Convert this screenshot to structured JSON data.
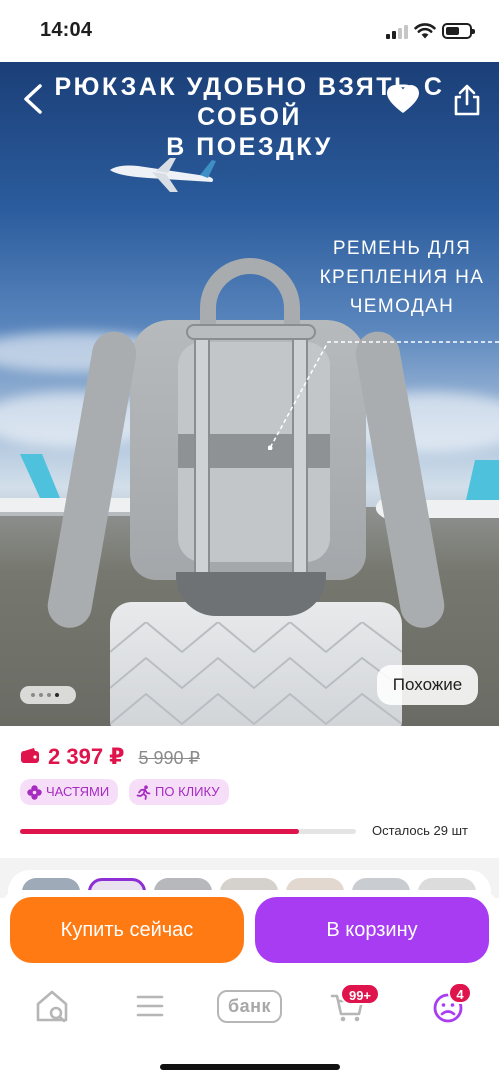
{
  "status_bar": {
    "time": "14:04"
  },
  "hero": {
    "title_line1": "рюкзак удобно взять с собой",
    "title_line2": "в поездку",
    "strap_note": "ремень для крепления на чемодан",
    "pager": {
      "total": 4,
      "active_index": 3
    },
    "similar_label": "Похожие",
    "icons": {
      "back": "chevron-left-icon",
      "favorite": "heart-icon",
      "share": "share-icon"
    }
  },
  "product": {
    "price_current": "2 397 ₽",
    "price_old": "5 990 ₽",
    "tags": [
      {
        "label": "ЧАСТЯМИ",
        "icon": "flower-icon"
      },
      {
        "label": "ПО КЛИКУ",
        "icon": "running-person-icon"
      }
    ],
    "stock": {
      "text": "Осталось 29 шт",
      "fill_fraction": 0.83
    }
  },
  "actions": {
    "buy_now": "Купить сейчас",
    "add_to_cart": "В корзину"
  },
  "tabbar": {
    "bank_label": "банк",
    "cart_badge": "99+",
    "profile_badge": "4"
  },
  "colors": {
    "accent_red": "#e0144c",
    "buy_orange": "#ff7a13",
    "cart_purple": "#a73cf2",
    "tag_text": "#a52bc1",
    "tag_bg": "#f6ddf8"
  }
}
